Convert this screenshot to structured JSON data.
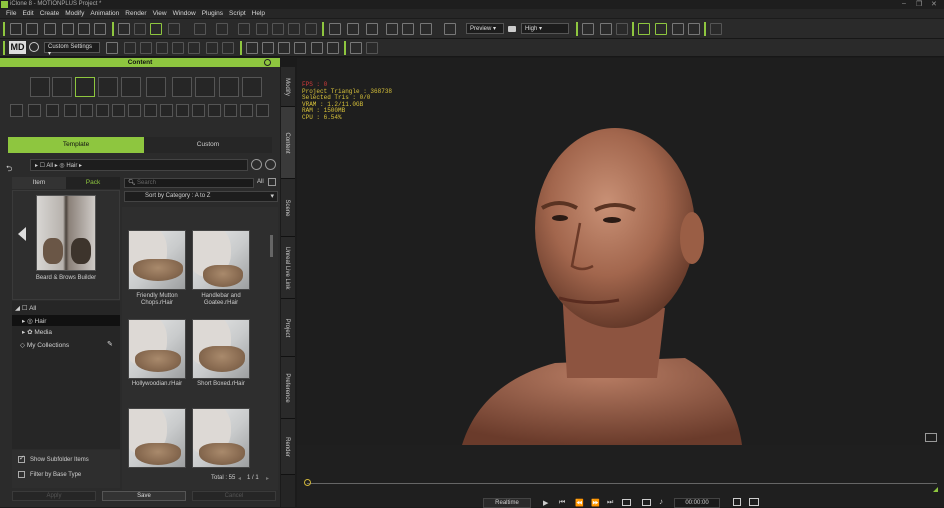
{
  "window": {
    "title": "iClone 8 - MOTIONPLUS Project *"
  },
  "menu": [
    "File",
    "Edit",
    "Create",
    "Modify",
    "Animation",
    "Render",
    "View",
    "Window",
    "Plugins",
    "Script",
    "Help"
  ],
  "toolbar": {
    "preview_label": "Preview",
    "quality_label": "High",
    "custom_settings_label": "Custom Settings"
  },
  "content": {
    "header": "Content",
    "tabs": {
      "template": "Template",
      "custom": "Custom"
    },
    "breadcrumb": [
      "All",
      "Hair"
    ],
    "subtabs": {
      "item": "Item",
      "pack": "Pack"
    },
    "pack_label": "Beard & Brows Builder",
    "search": {
      "placeholder": "Search",
      "filter_label": "All"
    },
    "sort_label": "Sort by Category : A to Z",
    "tree": [
      {
        "label": "All"
      },
      {
        "label": "Hair"
      },
      {
        "label": "Media"
      },
      {
        "label": "My Collections"
      }
    ],
    "items": [
      "Friendly Mutton Chops.rHair",
      "Handlebar and Goatee.rHair",
      "Hollywoodian.rHair",
      "Short Boxed.rHair"
    ],
    "options": {
      "show_subfolder": "Show Subfolder Items",
      "filter_base": "Filter by Base Type"
    },
    "total_label": "Total : 55",
    "page_label": "1 / 1",
    "buttons": {
      "apply": "Apply",
      "save": "Save",
      "cancel": "Cancel"
    }
  },
  "side_tabs": [
    "Modify",
    "Content",
    "Scene",
    "Unreal Live Link",
    "Project",
    "Preference",
    "Render"
  ],
  "stats": {
    "fps": "FPS : 0",
    "project_triangle": "Project Triangle : 368738",
    "selected_tris": "Selected Tris : 0/0",
    "vram": "VRAM : 1.2/11.0GB",
    "ram": "RAM : 1500MB",
    "cpu": "CPU : 6.54%"
  },
  "timeline": {
    "mode": "Realtime",
    "time": "00:00:00"
  }
}
